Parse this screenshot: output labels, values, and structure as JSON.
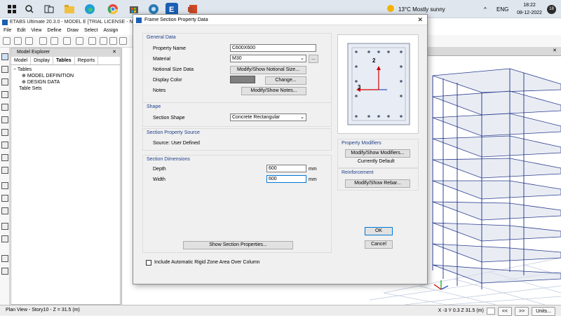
{
  "taskbar": {
    "weather": "13°C  Mostly sunny",
    "lang": "ENG",
    "time": "18:22",
    "date": "08-12-2022",
    "notifications": "18"
  },
  "app": {
    "title": "ETABS Ultimate 20.3.0 - MODEL E  [TRIAL LICENSE - NOT",
    "menu": [
      "File",
      "Edit",
      "View",
      "Define",
      "Draw",
      "Select",
      "Assign"
    ]
  },
  "explorer": {
    "title": "Model Explorer",
    "tabs": [
      "Model",
      "Display",
      "Tables",
      "Reports"
    ],
    "tree": [
      "Tables",
      "MODEL DEFINITION",
      "DESIGN DATA",
      "Table Sets"
    ]
  },
  "dialog": {
    "title": "Frame Section Property Data",
    "general_data": {
      "heading": "General Data",
      "property_name_label": "Property Name",
      "property_name_value": "C600X600",
      "material_label": "Material",
      "material_value": "M30",
      "material_more": "...",
      "notional_label": "Notional Size Data",
      "notional_button": "Modify/Show Notional Size...",
      "color_label": "Display Color",
      "color_button": "Change...",
      "color_swatch": "#808080",
      "notes_label": "Notes",
      "notes_button": "Modify/Show Notes..."
    },
    "shape": {
      "heading": "Shape",
      "shape_label": "Section Shape",
      "shape_value": "Concrete Rectangular"
    },
    "source": {
      "heading": "Section Property Source",
      "text": "Source:  User Defined"
    },
    "dimensions": {
      "heading": "Section Dimensions",
      "depth_label": "Depth",
      "depth_value": "600",
      "depth_unit": "mm",
      "width_label": "Width",
      "width_value": "600",
      "width_unit": "mm"
    },
    "show_props_button": "Show Section Properties...",
    "rigid_zone_label": "Include Automatic Rigid Zone Area Over Column",
    "modifiers": {
      "heading": "Property Modifiers",
      "button": "Modify/Show Modifiers...",
      "status": "Currently Default"
    },
    "reinforcement": {
      "heading": "Reinforcement",
      "button": "Modify/Show Rebar..."
    },
    "ok": "OK",
    "cancel": "Cancel",
    "preview_axis_2": "2",
    "preview_axis_3": "3"
  },
  "statusbar": {
    "left": "Plan View - Story10 - Z = 31.5 (m)",
    "coords": "X -3  Y 0.3  Z 31.5 (m)",
    "nav_prev": "<<",
    "nav_next": ">>",
    "units": "Units..."
  }
}
